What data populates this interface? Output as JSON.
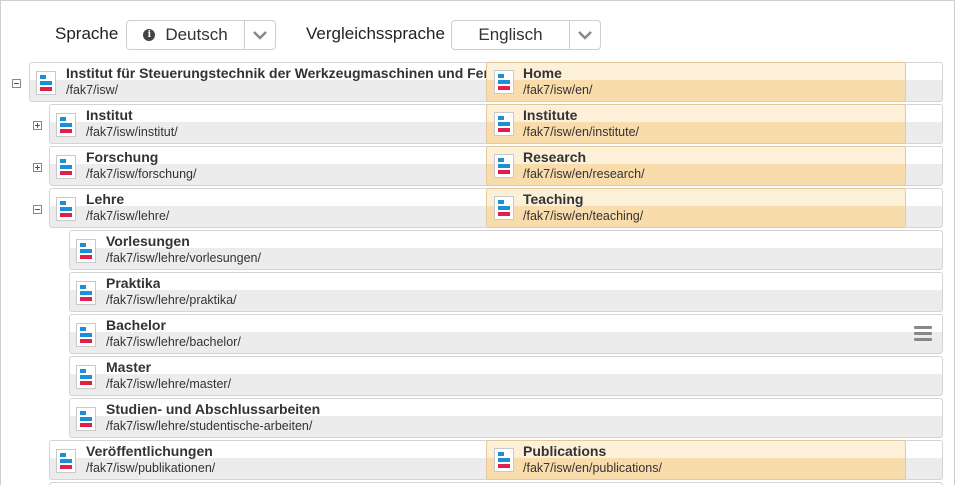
{
  "toolbar": {
    "language_label": "Sprache",
    "language_value": "Deutsch",
    "compare_label": "Vergleichssprache",
    "compare_value": "Englisch"
  },
  "rows": [
    {
      "title": "Institut für Steuerungstechnik der Werkzeugmaschinen und Fertigungseinrichtungen",
      "path": "/fak7/isw/",
      "en_title": "Home",
      "en_path": "/fak7/isw/en/",
      "toggle": "minus"
    },
    {
      "title": "Institut",
      "path": "/fak7/isw/institut/",
      "en_title": "Institute",
      "en_path": "/fak7/isw/en/institute/",
      "toggle": "plus"
    },
    {
      "title": "Forschung",
      "path": "/fak7/isw/forschung/",
      "en_title": "Research",
      "en_path": "/fak7/isw/en/research/",
      "toggle": "plus"
    },
    {
      "title": "Lehre",
      "path": "/fak7/isw/lehre/",
      "en_title": "Teaching",
      "en_path": "/fak7/isw/en/teaching/",
      "toggle": "minus"
    },
    {
      "title": "Vorlesungen",
      "path": "/fak7/isw/lehre/vorlesungen/"
    },
    {
      "title": "Praktika",
      "path": "/fak7/isw/lehre/praktika/"
    },
    {
      "title": "Bachelor",
      "path": "/fak7/isw/lehre/bachelor/"
    },
    {
      "title": "Master",
      "path": "/fak7/isw/lehre/master/"
    },
    {
      "title": "Studien- und Abschlussarbeiten",
      "path": "/fak7/isw/lehre/studentische-arbeiten/"
    },
    {
      "title": "Veröffentlichungen",
      "path": "/fak7/isw/publikationen/",
      "en_title": "Publications",
      "en_path": "/fak7/isw/en/publications/"
    }
  ]
}
